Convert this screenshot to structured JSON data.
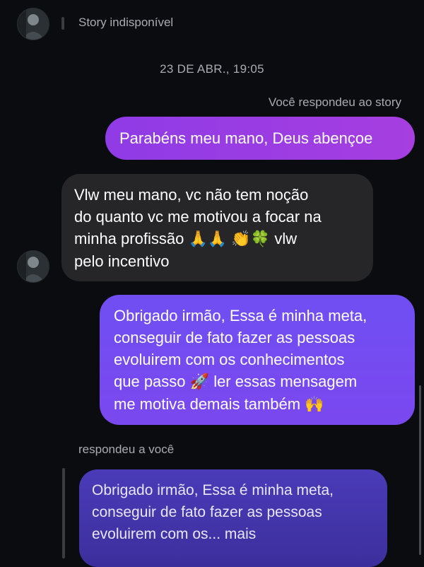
{
  "thread": {
    "story_status": "Story indisponível",
    "date_separator": "23 DE ABR., 19:05",
    "story_reply_label": "Você respondeu ao story",
    "reply_to_you_label": "respondeu a você"
  },
  "messages": {
    "sent_1": "Parabéns meu mano, Deus abençoe",
    "received_1": {
      "lines": [
        "Vlw meu mano, vc não tem noção",
        "do quanto vc me motivou a focar na",
        "minha profissão",
        "pelo incentivo"
      ],
      "emojis": [
        "🙏",
        "🙏",
        "👏",
        "🍀"
      ],
      "trailing": "vlw"
    },
    "sent_2": {
      "lines": [
        "Obrigado irmão, Essa é minha meta,",
        "conseguir de fato fazer as pessoas",
        "evoluirem com os conhecimentos",
        "que passo",
        "me motiva demais também"
      ],
      "rocket_emoji": "🚀",
      "after_rocket": "ler essas mensagem",
      "end_emoji": "🙌"
    },
    "quoted": {
      "lines": [
        "Obrigado irmão, Essa é minha meta,",
        "conseguir de fato fazer as pessoas",
        "evoluirem com os... mais"
      ]
    }
  },
  "colors": {
    "background": "#0b0c0f",
    "sent_gradient_start": "#8f3be6",
    "sent_gradient_end": "#6f4ff2",
    "received_bubble": "#262628",
    "muted_text": "#a9abb1"
  },
  "icons": {
    "avatar": "user-avatar",
    "story_bar": "story-indicator"
  }
}
